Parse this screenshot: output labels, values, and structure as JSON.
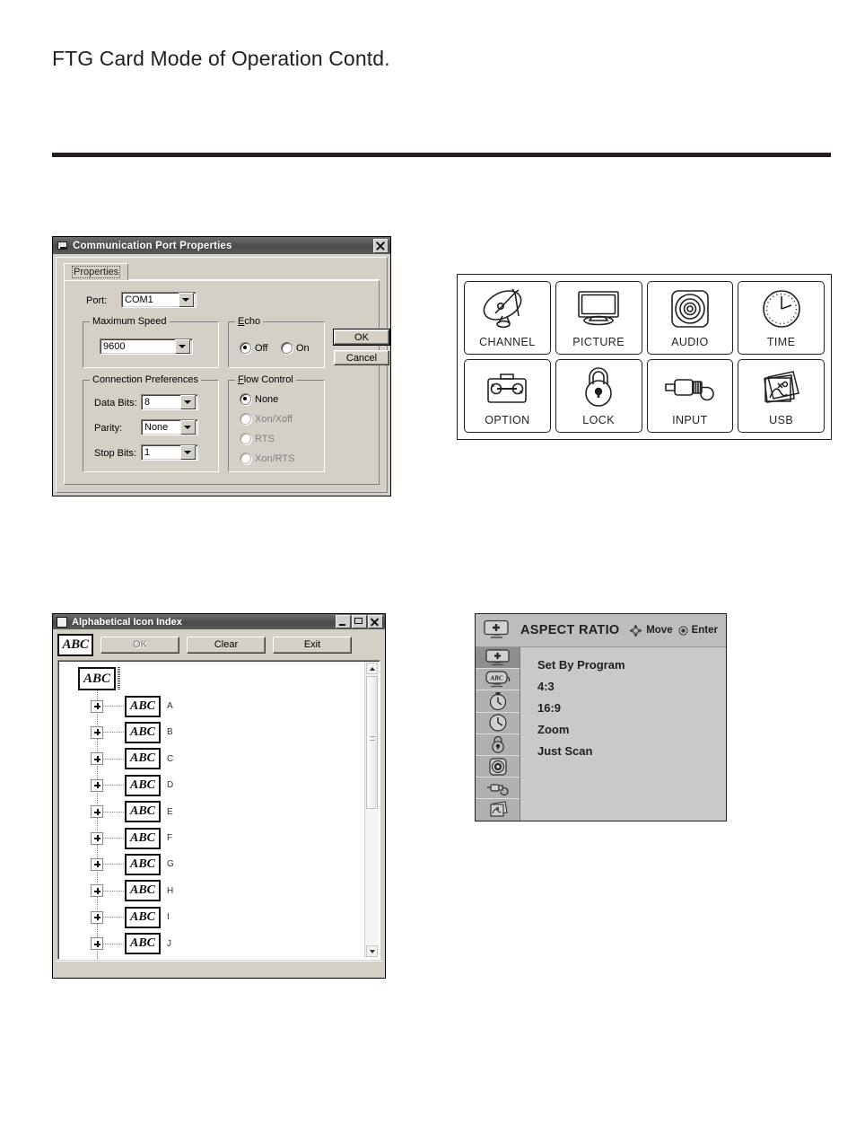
{
  "page": {
    "title": "FTG Card Mode of Operation Contd."
  },
  "comm_dialog": {
    "title": "Communication Port Properties",
    "title_icon": "serial-port-icon",
    "close_icon": "close-icon",
    "tab": "Properties",
    "port_label": "Port:",
    "port_value": "COM1",
    "max_speed_group": "Maximum Speed",
    "max_speed_value": "9600",
    "echo_group": "Echo",
    "echo_options": [
      {
        "label": "Off",
        "selected": true
      },
      {
        "label": "On",
        "selected": false
      }
    ],
    "connection_group": "Connection Preferences",
    "connection_fields": [
      {
        "label": "Data Bits:",
        "value": "8"
      },
      {
        "label": "Parity:",
        "value": "None"
      },
      {
        "label": "Stop Bits:",
        "value": "1"
      }
    ],
    "flow_group": "Flow Control",
    "flow_options": [
      {
        "label": "None",
        "selected": true,
        "disabled": false
      },
      {
        "label": "Xon/Xoff",
        "selected": false,
        "disabled": true
      },
      {
        "label": "RTS",
        "selected": false,
        "disabled": true
      },
      {
        "label": "Xon/RTS",
        "selected": false,
        "disabled": true
      }
    ],
    "ok_label": "OK",
    "cancel_label": "Cancel"
  },
  "tv_menu": {
    "cells": [
      {
        "caption": "CHANNEL",
        "icon": "satellite-dish-icon"
      },
      {
        "caption": "PICTURE",
        "icon": "monitor-icon"
      },
      {
        "caption": "AUDIO",
        "icon": "speaker-icon"
      },
      {
        "caption": "TIME",
        "icon": "clock-icon"
      },
      {
        "caption": "OPTION",
        "icon": "toolbox-wrench-icon"
      },
      {
        "caption": "LOCK",
        "icon": "padlock-icon"
      },
      {
        "caption": "INPUT",
        "icon": "plug-cable-icon"
      },
      {
        "caption": "USB",
        "icon": "usb-photos-icon"
      }
    ]
  },
  "icon_index": {
    "title": "Alphabetical Icon Index",
    "title_icon": "window-icon",
    "minimize_icon": "minimize-icon",
    "maximize_icon": "maximize-icon",
    "close_icon": "close-icon",
    "logo_text": "ABC",
    "buttons": [
      {
        "label": "OK",
        "disabled": true
      },
      {
        "label": "Clear",
        "disabled": false
      },
      {
        "label": "Exit",
        "disabled": false
      }
    ],
    "root_text": "ABC",
    "tree_items": [
      {
        "icon_text": "ABC",
        "letter": "A"
      },
      {
        "icon_text": "ABC",
        "letter": "B"
      },
      {
        "icon_text": "ABC",
        "letter": "C"
      },
      {
        "icon_text": "ABC",
        "letter": "D"
      },
      {
        "icon_text": "ABC",
        "letter": "E"
      },
      {
        "icon_text": "ABC",
        "letter": "F"
      },
      {
        "icon_text": "ABC",
        "letter": "G"
      },
      {
        "icon_text": "ABC",
        "letter": "H"
      },
      {
        "icon_text": "ABC",
        "letter": "I"
      },
      {
        "icon_text": "ABC",
        "letter": "J"
      }
    ],
    "scrollbar": {
      "up_icon": "chevron-up-icon",
      "down_icon": "chevron-down-icon"
    }
  },
  "osd": {
    "header_icon": "picture-plus-icon",
    "title": "ASPECT RATIO",
    "hints": [
      {
        "icon": "dpad-icon",
        "label": "Move"
      },
      {
        "icon": "enter-circle-icon",
        "label": "Enter"
      }
    ],
    "rail_icons": [
      {
        "name": "picture-plus-icon",
        "active": true
      },
      {
        "name": "channel-abc-icon",
        "active": false
      },
      {
        "name": "timer-icon",
        "active": false
      },
      {
        "name": "clock-icon",
        "active": false
      },
      {
        "name": "lock-icon",
        "active": false
      },
      {
        "name": "audio-icon",
        "active": false
      },
      {
        "name": "input-plug-icon",
        "active": false
      },
      {
        "name": "usb-photos-icon",
        "active": false
      }
    ],
    "items": [
      {
        "label": "Set By Program"
      },
      {
        "label": "4:3"
      },
      {
        "label": "16:9"
      },
      {
        "label": "Zoom"
      },
      {
        "label": "Just Scan"
      }
    ]
  },
  "colors": {
    "ink": "#231f20",
    "dialog_face": "#d4d0c8",
    "osd_body": "#c9c9c9",
    "osd_rail": "#b0b0b0",
    "osd_rail_active": "#8e8e8e"
  }
}
